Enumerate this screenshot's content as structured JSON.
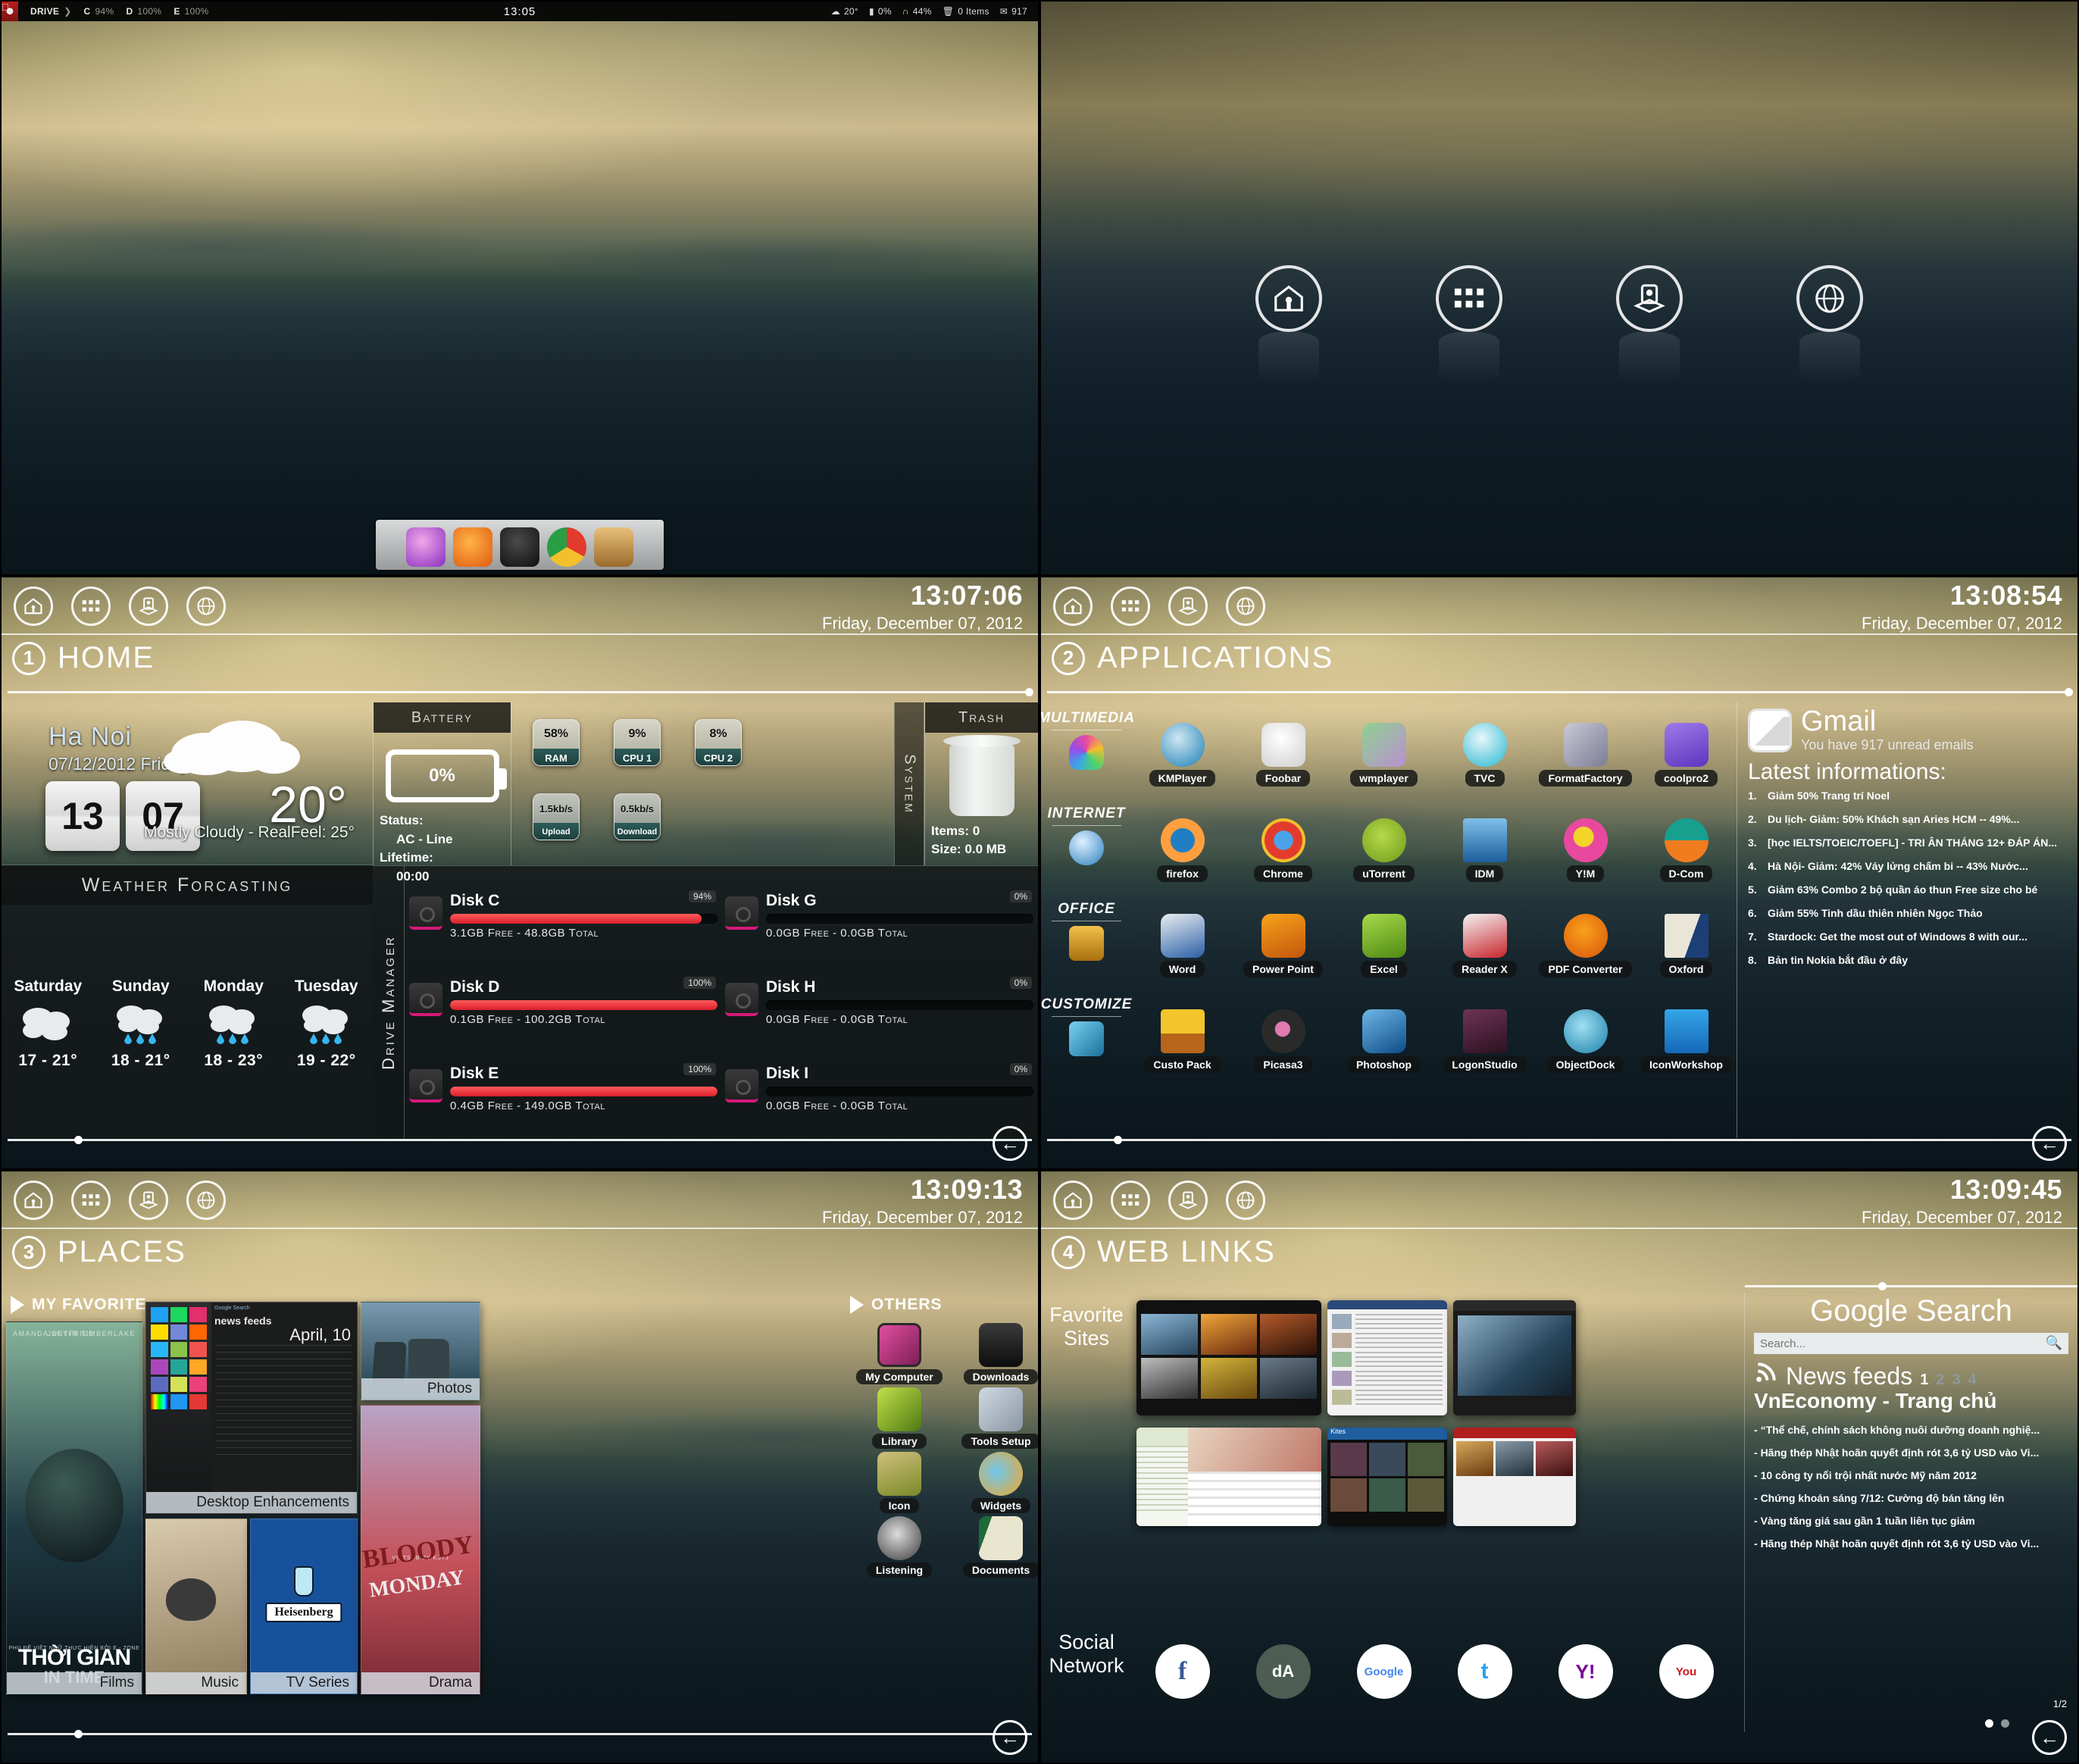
{
  "menubar": {
    "drive_label": "DRIVE",
    "drives": [
      {
        "letter": "C",
        "pct": "94%"
      },
      {
        "letter": "D",
        "pct": "100%"
      },
      {
        "letter": "E",
        "pct": "100%"
      }
    ],
    "clock": "13:05",
    "status": [
      {
        "icon": "cloud-icon",
        "value": "20°"
      },
      {
        "icon": "battery-icon",
        "value": "0%"
      },
      {
        "icon": "headphones-icon",
        "value": "44%"
      },
      {
        "icon": "trash-icon",
        "value": "0 Items"
      },
      {
        "icon": "mail-icon",
        "value": "917"
      }
    ]
  },
  "dock": {
    "items": [
      "itunes-icon",
      "firefox-icon",
      "android-icon",
      "chrome-icon",
      "basket-icon"
    ]
  },
  "launcher_circles": [
    "home-icon",
    "apps-grid-icon",
    "places-icon",
    "globe-icon"
  ],
  "nav": {
    "buttons": [
      "home-icon",
      "apps-grid-icon",
      "places-icon",
      "globe-icon"
    ],
    "back_label": "←"
  },
  "panels": {
    "home": {
      "number": "1",
      "title": "HOME",
      "clock": "13:07:06",
      "date": "Friday, December 07, 2012",
      "weather": {
        "city": "Ha Noi",
        "date": "07/12/2012 Friday",
        "hour": "13",
        "minute": "07",
        "temp": "20°",
        "condition": "Mostly Cloudy - RealFeel: 25°",
        "forecast_title": "Weather Forcasting",
        "forecast": [
          {
            "day": "Saturday",
            "icon": "cloudy-icon",
            "range": "17 - 21°"
          },
          {
            "day": "Sunday",
            "icon": "rain-icon",
            "range": "18 - 21°"
          },
          {
            "day": "Monday",
            "icon": "rain-icon",
            "range": "18 - 23°"
          },
          {
            "day": "Tuesday",
            "icon": "rain-icon",
            "range": "19 - 22°"
          }
        ]
      },
      "battery": {
        "header": "Battery",
        "percent": "0%",
        "status_label": "Status:",
        "status_value": "AC - Line",
        "lifetime_label": "Lifetime:",
        "lifetime_value": "00:00"
      },
      "system_label": "System",
      "tiles": [
        {
          "value": "58%",
          "label": "RAM"
        },
        {
          "value": "9%",
          "label": "CPU 1"
        },
        {
          "value": "8%",
          "label": "CPU 2"
        },
        {
          "value": "1.5kb/s",
          "label": "Upload"
        },
        {
          "value": "0.5kb/s",
          "label": "Download"
        }
      ],
      "trash": {
        "header": "Trash",
        "items": "Items: 0",
        "size": "Size: 0.0 MB"
      },
      "drive_manager_label": "Drive Manager",
      "disks": [
        {
          "name": "Disk C",
          "pct": "94%",
          "fill": 94,
          "detail": "3.1GB Free - 48.8GB Total"
        },
        {
          "name": "Disk D",
          "pct": "100%",
          "fill": 100,
          "detail": "0.1GB Free - 100.2GB Total"
        },
        {
          "name": "Disk E",
          "pct": "100%",
          "fill": 100,
          "detail": "0.4GB Free - 149.0GB Total"
        },
        {
          "name": "Disk G",
          "pct": "0%",
          "fill": 0,
          "detail": "0.0GB Free - 0.0GB Total"
        },
        {
          "name": "Disk H",
          "pct": "0%",
          "fill": 0,
          "detail": "0.0GB Free - 0.0GB Total"
        },
        {
          "name": "Disk I",
          "pct": "0%",
          "fill": 0,
          "detail": "0.0GB Free - 0.0GB Total"
        }
      ]
    },
    "applications": {
      "number": "2",
      "title": "APPLICATIONS",
      "clock": "13:08:54",
      "date": "Friday, December 07, 2012",
      "categories": [
        {
          "name": "MULTIMEDIA",
          "icon": "color-lamp-icon",
          "apps": [
            {
              "label": "KMPlayer",
              "icon": "kmplayer-icon",
              "c1": "#cfe7f2",
              "c2": "#1b7fb5"
            },
            {
              "label": "Foobar",
              "icon": "foobar-icon",
              "c1": "#ffffff",
              "c2": "#cfcfcf"
            },
            {
              "label": "wmplayer",
              "icon": "wmplayer-icon",
              "c1": "#8fd18f",
              "c2": "#b98fd1"
            },
            {
              "label": "TVC",
              "icon": "tvc-icon",
              "c1": "#e8f7fb",
              "c2": "#25b7cf"
            },
            {
              "label": "FormatFactory",
              "icon": "formatfactory-icon",
              "c1": "#c9c9d6",
              "c2": "#7c7c95"
            },
            {
              "label": "coolpro2",
              "icon": "coolpro2-icon",
              "c1": "#9d7ae8",
              "c2": "#5d35c0"
            }
          ]
        },
        {
          "name": "INTERNET",
          "icon": "globe-blue-icon",
          "apps": [
            {
              "label": "firefox",
              "icon": "firefox-icon",
              "c1": "#ff9f3f",
              "c2": "#1f7ec4"
            },
            {
              "label": "Chrome",
              "icon": "chrome-icon",
              "c1": "#e23b2e",
              "c2": "#f3c02c"
            },
            {
              "label": "uTorrent",
              "icon": "utorrent-icon",
              "c1": "#b5d94a",
              "c2": "#6f9b18"
            },
            {
              "label": "IDM",
              "icon": "idm-icon",
              "c1": "#7ec0ea",
              "c2": "#1d5e9c"
            },
            {
              "label": "Y!M",
              "icon": "yim-icon",
              "c1": "#e8499e",
              "c2": "#7a1ea4"
            },
            {
              "label": "D-Com",
              "icon": "viettel-icon",
              "c1": "#17a08e",
              "c2": "#f07c1e"
            }
          ]
        },
        {
          "name": "OFFICE",
          "icon": "toolbox-icon",
          "apps": [
            {
              "label": "Word",
              "icon": "word-icon",
              "c1": "#eaeef3",
              "c2": "#2b5fa5"
            },
            {
              "label": "Power Point",
              "icon": "powerpoint-icon",
              "c1": "#f7a21a",
              "c2": "#c4560c"
            },
            {
              "label": "Excel",
              "icon": "excel-icon",
              "c1": "#a8d94a",
              "c2": "#4e8a12"
            },
            {
              "label": "Reader X",
              "icon": "readerx-icon",
              "c1": "#f4f4f4",
              "c2": "#c8252c"
            },
            {
              "label": "PDF Converter",
              "icon": "pdfconverter-icon",
              "c1": "#f9a11b",
              "c2": "#d8540a"
            },
            {
              "label": "Oxford",
              "icon": "oxford-icon",
              "c1": "#e9e6d8",
              "c2": "#1d3f77"
            }
          ]
        },
        {
          "name": "CUSTOMIZE",
          "icon": "paint-icon",
          "apps": [
            {
              "label": "Custo Pack",
              "icon": "custopack-icon",
              "c1": "#f3c52b",
              "c2": "#b6651a"
            },
            {
              "label": "Picasa3",
              "icon": "picasa-icon",
              "c1": "#9a9a9a",
              "c2": "#1c1c1c"
            },
            {
              "label": "Photoshop",
              "icon": "photoshop-icon",
              "c1": "#6fb7e8",
              "c2": "#0c4c86"
            },
            {
              "label": "LogonStudio",
              "icon": "logonstudio-icon",
              "c1": "#6f3355",
              "c2": "#2a1220"
            },
            {
              "label": "ObjectDock",
              "icon": "objectdock-icon",
              "c1": "#55c3e8",
              "c2": "#1a7fa8"
            },
            {
              "label": "IconWorkshop",
              "icon": "iconworkshop-icon",
              "c1": "#34a5e8",
              "c2": "#1668b8"
            }
          ]
        }
      ],
      "gmail": {
        "title": "Gmail",
        "subtitle": "You have 917 unread emails",
        "latest_title": "Latest informations:",
        "items": [
          "Giảm 50% Trang trí Noel",
          "Du lịch- Giảm: 50% Khách sạn Aries HCM -- 49%...",
          "[học IELTS/TOEIC/TOEFL] - TRI ÂN THÁNG 12+ ĐÁP ÁN...",
          "Hà Nội- Giảm: 42% Váy lửng chấm bi -- 43% Nước...",
          "Giảm 63% Combo 2 bộ quần áo thun Free size cho bé",
          "Giảm 55% Tinh dầu thiên nhiên Ngọc Thảo",
          "Stardock: Get the most out of Windows 8 with our...",
          "Bản tin Nokia bắt đầu ở đây"
        ]
      }
    },
    "places": {
      "number": "3",
      "title": "PLACES",
      "clock": "13:09:13",
      "date": "Friday, December 07, 2012",
      "favorite_label": "MY FAVORITE",
      "others_label": "OTHERS",
      "tiles": [
        {
          "caption": "Films",
          "icon": "film-poster"
        },
        {
          "caption": "Desktop Enhancements",
          "icon": "desktop-shot"
        },
        {
          "caption": "Photos",
          "icon": "photo-shot"
        },
        {
          "caption": "Music",
          "icon": "music-shot"
        },
        {
          "caption": "TV Series",
          "icon": "tvseries-shot"
        },
        {
          "caption": "Drama",
          "icon": "drama-poster"
        }
      ],
      "film_poster": {
        "actor_left": "AMANDA SEYFRIED",
        "actor_right": "JUSTIN TIMBERLAKE",
        "sub": "PHỤ ĐỀ VIỆT NGỮ THỰC HIỆN BỞI E - ZONE",
        "title1": "THỜI GIAN",
        "title2": "IN TIME"
      },
      "desktop_shot": {
        "search_label": "Google Search",
        "heading": "news feeds",
        "date_label": "April, 10"
      },
      "tvseries_logo": "Heisenberg",
      "drama_poster": {
        "line1": "VIETSUB BY KSTJ",
        "line2": "BLOODY",
        "line3": "MONDAY"
      },
      "others": [
        {
          "label": "My Computer",
          "icon": "monitor-icon",
          "c1": "#e24fa0",
          "c2": "#7c1f55"
        },
        {
          "label": "Downloads",
          "icon": "download-box-icon",
          "c1": "#2a2a2a",
          "c2": "#0d0d0d"
        },
        {
          "label": "Library",
          "icon": "library-icon",
          "c1": "#c2e04a",
          "c2": "#4e7a12"
        },
        {
          "label": "Tools Setup",
          "icon": "tools-icon",
          "c1": "#cfd9e2",
          "c2": "#8a96a3"
        },
        {
          "label": "Icon",
          "icon": "bamboo-icon",
          "c1": "#cfc07a",
          "c2": "#7b8a2a"
        },
        {
          "label": "Widgets",
          "icon": "fish-icon",
          "c1": "#f0a52a",
          "c2": "#1f7fc0"
        },
        {
          "label": "Listening",
          "icon": "headphones-icon",
          "c1": "#c9c9c9",
          "c2": "#4a4a4a"
        },
        {
          "label": "Documents",
          "icon": "book-icon",
          "c1": "#e9e6d0",
          "c2": "#1e6b3a"
        }
      ]
    },
    "weblinks": {
      "number": "4",
      "title": "WEB LINKS",
      "clock": "13:09:45",
      "date": "Friday, December 07, 2012",
      "favorite_sites_label": "Favorite\nSites",
      "social_network_label": "Social\nNetwork",
      "social": [
        {
          "name": "facebook-icon",
          "glyph": "f",
          "bg": "#ffffff",
          "fg": "#3b5998"
        },
        {
          "name": "deviantart-icon",
          "glyph": "dA",
          "bg": "#4d5d53",
          "fg": "#ffffff"
        },
        {
          "name": "google-icon",
          "glyph": "Google",
          "bg": "#ffffff",
          "fg": "#4285f4"
        },
        {
          "name": "twitter-icon",
          "glyph": "t",
          "bg": "#ffffff",
          "fg": "#2aa3ef"
        },
        {
          "name": "yahoo-icon",
          "glyph": "Y!",
          "bg": "#ffffff",
          "fg": "#7b0099"
        },
        {
          "name": "youtube-icon",
          "glyph": "You",
          "bg": "#ffffff",
          "fg": "#cc181e"
        }
      ],
      "google_search": {
        "title": "Google Search",
        "placeholder": "Search...",
        "value": ""
      },
      "news": {
        "title": "News feeds",
        "pages": [
          "1",
          "2",
          "3",
          "4"
        ],
        "active_page": "1",
        "feed_name": "VnEconomy - Trang chủ",
        "items": [
          "“Thể chế, chính sách không nuôi dưỡng doanh nghiệ...",
          "Hãng thép Nhật hoãn quyết định rót 3,6 tỷ USD vào Vi...",
          "10 công ty nổi trội nhất nước Mỹ năm 2012",
          "Chứng khoán sáng 7/12: Cường độ bán tăng lên",
          "Vàng tăng giá sau gần 1 tuần liên tục giảm",
          "Hãng thép Nhật hoãn quyết định rót 3,6 tỷ USD vào Vi..."
        ],
        "page_indicator": "1/2"
      }
    }
  }
}
